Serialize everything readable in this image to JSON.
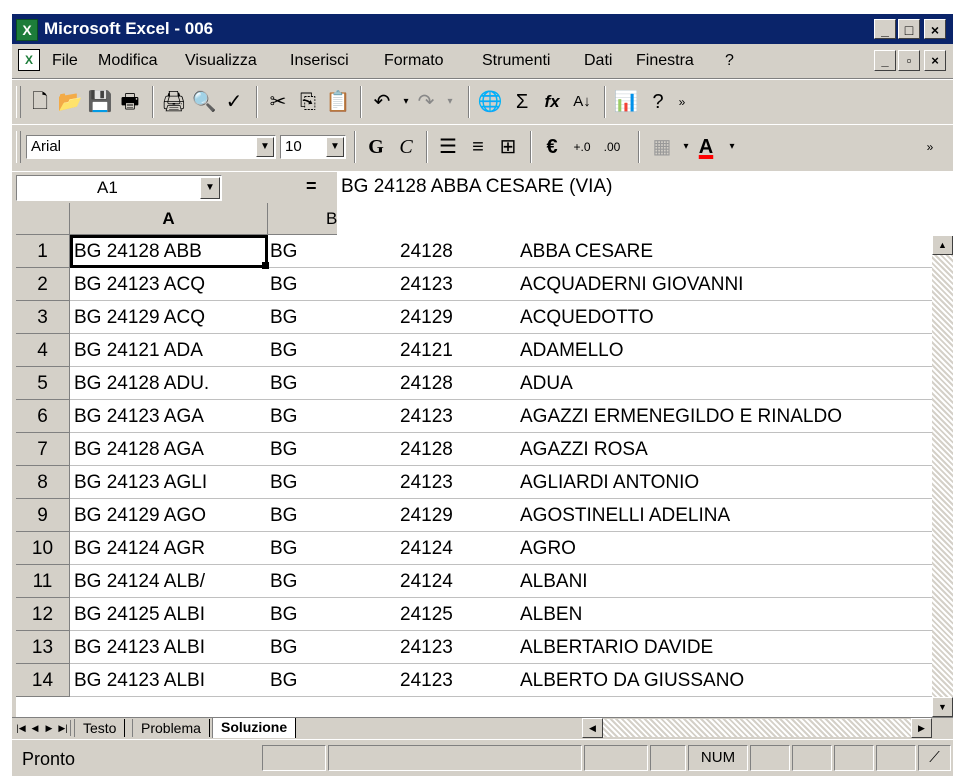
{
  "window": {
    "title": "Microsoft Excel - 006"
  },
  "menu": {
    "items": [
      "File",
      "Modifica",
      "Visualizza",
      "Inserisci",
      "Formato",
      "Strumenti",
      "Dati",
      "Finestra",
      "?"
    ]
  },
  "format_toolbar": {
    "font": "Arial",
    "size": "10",
    "bold": "G",
    "italic": "C",
    "currency": "€",
    "underline_color": "#ff0000"
  },
  "formula_bar": {
    "cell_ref": "A1",
    "equals": "=",
    "content": "BG  24128  ABBA CESARE (VIA)"
  },
  "grid": {
    "columns": [
      "A",
      "B"
    ],
    "rows": [
      {
        "n": "1",
        "a": "BG  24128  ABB",
        "b": "BG",
        "c": "24128",
        "d": "ABBA CESARE"
      },
      {
        "n": "2",
        "a": "BG  24123  ACQ",
        "b": "BG",
        "c": "24123",
        "d": "ACQUADERNI GIOVANNI"
      },
      {
        "n": "3",
        "a": "BG  24129  ACQ",
        "b": "BG",
        "c": "24129",
        "d": "ACQUEDOTTO"
      },
      {
        "n": "4",
        "a": "BG  24121  ADA",
        "b": "BG",
        "c": "24121",
        "d": "ADAMELLO"
      },
      {
        "n": "5",
        "a": "BG  24128  ADU.",
        "b": "BG",
        "c": "24128",
        "d": "ADUA"
      },
      {
        "n": "6",
        "a": "BG  24123  AGA",
        "b": "BG",
        "c": "24123",
        "d": "AGAZZI ERMENEGILDO E RINALDO"
      },
      {
        "n": "7",
        "a": "BG  24128  AGA",
        "b": "BG",
        "c": "24128",
        "d": "AGAZZI ROSA"
      },
      {
        "n": "8",
        "a": "BG  24123  AGLI",
        "b": "BG",
        "c": "24123",
        "d": "AGLIARDI ANTONIO"
      },
      {
        "n": "9",
        "a": "BG  24129  AGO",
        "b": "BG",
        "c": "24129",
        "d": "AGOSTINELLI ADELINA"
      },
      {
        "n": "10",
        "a": "BG  24124  AGR",
        "b": "BG",
        "c": "24124",
        "d": "AGRO"
      },
      {
        "n": "11",
        "a": "BG  24124  ALB/",
        "b": "BG",
        "c": "24124",
        "d": "ALBANI"
      },
      {
        "n": "12",
        "a": "BG  24125  ALBI",
        "b": "BG",
        "c": "24125",
        "d": "ALBEN"
      },
      {
        "n": "13",
        "a": "BG  24123  ALBI",
        "b": "BG",
        "c": "24123",
        "d": "ALBERTARIO DAVIDE"
      },
      {
        "n": "14",
        "a": "BG  24123  ALBI",
        "b": "BG",
        "c": "24123",
        "d": "ALBERTO DA GIUSSANO"
      }
    ]
  },
  "sheet_tabs": [
    "Testo",
    "Problema",
    "Soluzione"
  ],
  "active_tab": "Soluzione",
  "status": {
    "text": "Pronto",
    "num": "NUM"
  }
}
